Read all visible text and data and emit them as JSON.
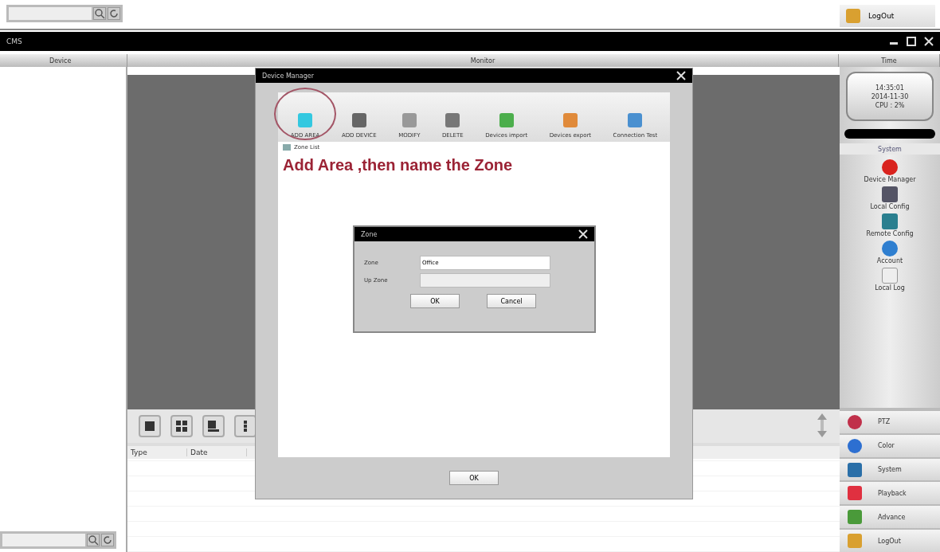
{
  "top_bar": {
    "logout": "LogOut"
  },
  "window": {
    "title": "CMS"
  },
  "panels": {
    "device": "Device",
    "monitor": "Monitor",
    "time": "Time"
  },
  "clock": {
    "time": "14:35:01",
    "date": "2014-11-30",
    "cpu": "CPU : 2%"
  },
  "system": {
    "title": "System",
    "items": [
      {
        "label": "Device Manager"
      },
      {
        "label": "Local Config"
      },
      {
        "label": "Remote Config"
      },
      {
        "label": "Account"
      },
      {
        "label": "Local Log"
      }
    ]
  },
  "bottom_menu": [
    {
      "label": "PTZ"
    },
    {
      "label": "Color"
    },
    {
      "label": "System"
    },
    {
      "label": "Playback"
    },
    {
      "label": "Advance"
    },
    {
      "label": "LogOut"
    }
  ],
  "log_table": {
    "columns": [
      "Type",
      "Date"
    ]
  },
  "device_manager": {
    "title": "Device Manager",
    "toolbar": [
      {
        "label": "ADD AREA"
      },
      {
        "label": "ADD DEVICE"
      },
      {
        "label": "MODIFY"
      },
      {
        "label": "DELETE"
      },
      {
        "label": "Devices import"
      },
      {
        "label": "Devices export"
      },
      {
        "label": "Connection Test"
      }
    ],
    "zone_list": "Zone List",
    "annotation": "Add Area ,then name the Zone",
    "ok": "OK"
  },
  "zone_dialog": {
    "title": "Zone",
    "fields": [
      {
        "label": "Zone",
        "value": "Office",
        "disabled": false
      },
      {
        "label": "Up Zone",
        "disabled": true
      }
    ],
    "buttons": [
      "OK",
      "Cancel"
    ]
  }
}
